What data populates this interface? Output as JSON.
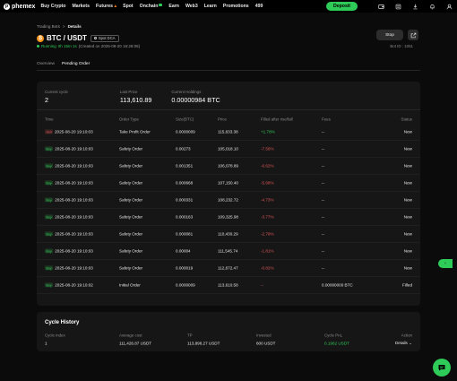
{
  "brand": {
    "name": "phemex",
    "accent": "#2fcb58"
  },
  "nav": {
    "items": [
      "Buy Crypto",
      "Markets",
      "Futures",
      "Spot",
      "Onchain",
      "Earn",
      "Web3",
      "Learn",
      "Promotions",
      "499"
    ],
    "deposit_label": "Deposit",
    "icons": [
      "wallet-icon",
      "assets-icon",
      "download-icon",
      "bell-icon",
      "user-icon"
    ]
  },
  "breadcrumb": {
    "parent": "Trading Bots",
    "separator": ">",
    "current": "Details"
  },
  "bot": {
    "pair": "BTC / USDT",
    "type_badge": "Spot DCA",
    "status": "Running",
    "runtime": "0h 15m 1s",
    "created": "(Created on 2025-08-20 16:28:06)",
    "stop_label": "Stop",
    "bot_id": "Bot ID : 1051"
  },
  "tabs": [
    "Overview",
    "Pending Order"
  ],
  "active_tab": 1,
  "summary": {
    "current_cycle_label": "Current cycle",
    "current_cycle": "2",
    "last_price_label": "Last Price",
    "last_price": "113,610.89",
    "holdings_label": "Current Holdings",
    "holdings": "0.00000984 BTC"
  },
  "table": {
    "headers": [
      "Time",
      "Order Type",
      "Size(BTC)",
      "Price",
      "Filled after rise/fall",
      "Fees",
      "Status"
    ],
    "rows": [
      {
        "side": "Sell",
        "time": "2025-08-20 19:10:03",
        "type": "Take Profit Order",
        "size": "0.0000009",
        "price": "115,633.38",
        "change": "+1.78%",
        "fees": "--",
        "status": "New"
      },
      {
        "side": "Buy",
        "time": "2025-08-20 19:10:03",
        "type": "Safety Order",
        "size": "0.00273",
        "price": "105,018.10",
        "change": "-7.56%",
        "fees": "--",
        "status": "New"
      },
      {
        "side": "Buy",
        "time": "2025-08-20 19:10:03",
        "type": "Safety Order",
        "size": "0.001351",
        "price": "106,078.89",
        "change": "-6.62%",
        "fees": "--",
        "status": "New"
      },
      {
        "side": "Buy",
        "time": "2025-08-20 19:10:03",
        "type": "Safety Order",
        "size": "0.000668",
        "price": "107,150.40",
        "change": "-5.68%",
        "fees": "--",
        "status": "New"
      },
      {
        "side": "Buy",
        "time": "2025-08-20 19:10:03",
        "type": "Safety Order",
        "size": "0.000331",
        "price": "108,232.72",
        "change": "-4.73%",
        "fees": "--",
        "status": "New"
      },
      {
        "side": "Buy",
        "time": "2025-08-20 19:10:03",
        "type": "Safety Order",
        "size": "0.000163",
        "price": "109,325.98",
        "change": "-3.77%",
        "fees": "--",
        "status": "New"
      },
      {
        "side": "Buy",
        "time": "2025-08-20 19:10:03",
        "type": "Safety Order",
        "size": "0.000081",
        "change": "-2.79%",
        "price": "110,430.29",
        "fees": "--",
        "status": "New"
      },
      {
        "side": "Buy",
        "time": "2025-08-20 19:10:03",
        "type": "Safety Order",
        "size": "0.00004",
        "price": "111,545.74",
        "change": "-1.81%",
        "fees": "--",
        "status": "New"
      },
      {
        "side": "Buy",
        "time": "2025-08-20 19:10:03",
        "type": "Safety Order",
        "size": "0.000019",
        "price": "112,672.47",
        "change": "-0.82%",
        "fees": "--",
        "status": "New"
      },
      {
        "side": "Buy",
        "time": "2025-08-20 19:10:02",
        "type": "Initial Order",
        "size": "0.0000009",
        "price": "113,610.58",
        "change": "--",
        "fees": "0.00000000 BTC",
        "status": "Filled"
      }
    ]
  },
  "cycle_history": {
    "title": "Cycle History",
    "headers": [
      "Cycle index",
      "Average cost",
      "TP",
      "Invested",
      "Cycle PnL",
      "Action"
    ],
    "row": {
      "index": "1",
      "avg_cost": "111,426.87 USDT",
      "tp": "113,898.27 USDT",
      "invested": "600 USDT",
      "pnl": "0.1962 USDT",
      "action": "Details"
    }
  }
}
